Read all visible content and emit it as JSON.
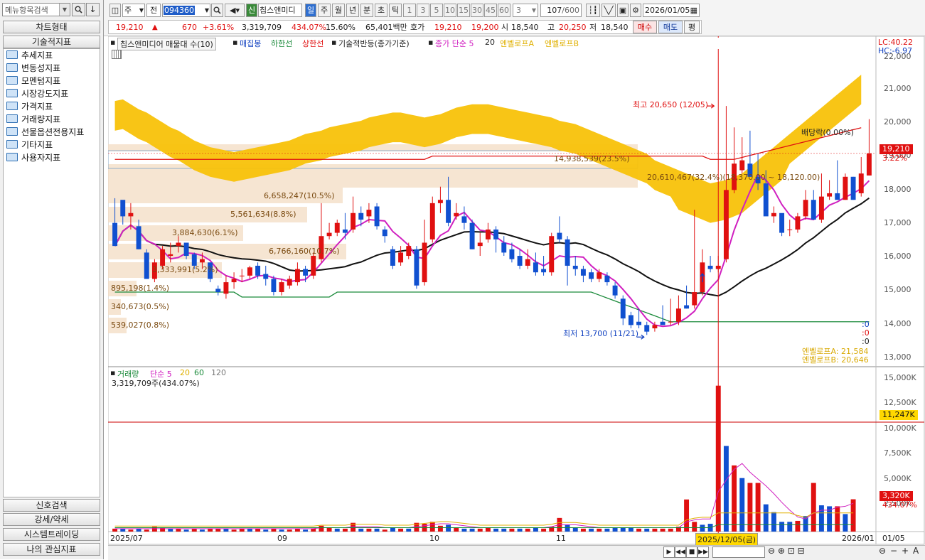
{
  "left_panel": {
    "search_placeholder": "메뉴항목검색",
    "chart_type": "차트형태",
    "tech_indicators": "기술적지표",
    "tree": [
      "추세지표",
      "변동성지표",
      "모멘텀지표",
      "시장강도지표",
      "가격지표",
      "거래량지표",
      "선물옵션전용지표",
      "기타지표",
      "사용자지표"
    ],
    "bottom": [
      "신호검색",
      "강세/약세",
      "시스템트레이딩",
      "나의 관심지표"
    ]
  },
  "toolbar": {
    "mode1": "주",
    "mode2": "전",
    "code": "094360",
    "stock_name": "칩스앤미디",
    "signal": "신",
    "periods": [
      "일",
      "주",
      "월",
      "년",
      "분",
      "초",
      "틱"
    ],
    "intervals": [
      "1",
      "3",
      "5",
      "10",
      "15",
      "30",
      "45",
      "60"
    ],
    "interval_select": "3",
    "count": "107",
    "count_total": "/600",
    "date": "2026/01/05"
  },
  "quote": {
    "price": "19,210",
    "change_arrow": "▲",
    "change": "670",
    "change_pct": "+3.61%",
    "volume": "3,319,709",
    "volume_ratio": "434.07%",
    "turnover": "15.60%",
    "amount": "65,401백만",
    "ask_label": "호가",
    "ask": "19,210",
    "bid": "19,200",
    "open_label": "시",
    "open": "18,540",
    "high_label": "고",
    "high": "20,250",
    "low_label": "저",
    "low": "18,540",
    "buy": "매수",
    "sell": "매도",
    "eval": "평"
  },
  "legend": {
    "title": "칩스앤미디어 매물대 수(10)",
    "items": [
      {
        "label": "매집봉",
        "color": "#1040c0"
      },
      {
        "label": "하한선",
        "color": "#1a8a3a"
      },
      {
        "label": "상한선",
        "color": "#e01010"
      },
      {
        "label": "기술적반등(종가기준)",
        "color": "#222222"
      },
      {
        "label": "종가 단순 5",
        "color": "#d020c0"
      },
      {
        "label": "20",
        "color": "#222222"
      },
      {
        "label": "엔벨로프A",
        "color": "#e0b000"
      },
      {
        "label": "엔벨로프B",
        "color": "#e0b000"
      }
    ],
    "lc": "LC:40.22",
    "hc": "HC:-6.97"
  },
  "annotations": {
    "high": "최고 20,650 (12/05)",
    "low": "최저 13,700 (11/21)",
    "dividend": "배당락(0.00%)",
    "price_box": "19,210",
    "price_pct": "3.22%",
    "env_a": "엔벨로프A: 21,584",
    "env_b": "엔벨로프B: 20,646",
    "zeros": [
      ":0",
      ":0",
      ":0"
    ],
    "profile": [
      "14,938,539(23.5%)",
      "20,610,467(32.4%)(18,370.00 ~ 18,120.00)",
      "6,658,247(10.5%)",
      "5,561,634(8.8%)",
      "3,884,630(6.1%)",
      "6,766,160(10.7%)",
      "3,333,991(5.2%)",
      "895,198(1.4%)",
      "340,673(0.5%)",
      "539,027(0.8%)"
    ]
  },
  "price_axis": [
    "22,000",
    "21,000",
    "20,000",
    "19,000",
    "18,000",
    "17,000",
    "16,000",
    "15,000",
    "14,000",
    "13,000"
  ],
  "volume_panel": {
    "legend_title": "거래량",
    "legend_items": [
      {
        "label": "단순 5",
        "color": "#d020c0"
      },
      {
        "label": "20",
        "color": "#e0b000"
      },
      {
        "label": "60",
        "color": "#1a8a3a"
      },
      {
        "label": "120",
        "color": "#777777"
      }
    ],
    "value": "3,319,709주(434.07%)",
    "axis": [
      "15,000K",
      "12,500K",
      "10,000K",
      "7,500K",
      "5,000K",
      "2,500K"
    ],
    "line_box": "11,247K",
    "vol_box": "3,320K",
    "vol_pct": "434.07%"
  },
  "x_axis": {
    "labels": [
      "2025/07",
      "09",
      "10",
      "11",
      "2026/01"
    ],
    "crosshair_date": "2025/12/05(금)",
    "right_label": "01/05"
  },
  "chart_data": {
    "type": "candlestick",
    "price_range": [
      12800,
      22400
    ],
    "volume_range": [
      0,
      16000
    ],
    "candles": [
      [
        17100,
        18100,
        17850,
        16400,
        16400
      ],
      [
        17800,
        17850,
        17600,
        17050,
        17300
      ],
      [
        17300,
        17450,
        17700,
        16900,
        17400
      ],
      [
        17000,
        17200,
        17200,
        16300,
        16300
      ],
      [
        16200,
        16250,
        16300,
        15400,
        15400
      ],
      [
        15400,
        16200,
        16000,
        15300,
        15900
      ],
      [
        15800,
        16000,
        16400,
        15700,
        16300
      ],
      [
        16100,
        16700,
        16500,
        15900,
        16150
      ],
      [
        16400,
        16300,
        16700,
        16200,
        16500
      ],
      [
        16500,
        16200,
        16500,
        16000,
        16100
      ],
      [
        16150,
        15800,
        16200,
        15700,
        15800
      ],
      [
        15900,
        16100,
        16200,
        15700,
        16000
      ],
      [
        15900,
        15400,
        15900,
        15300,
        15400
      ],
      [
        15100,
        15100,
        15200,
        14900,
        15000
      ],
      [
        14950,
        15300,
        15500,
        14800,
        15300
      ],
      [
        15300,
        15400,
        15600,
        15100,
        15400
      ],
      [
        15500,
        15600,
        15700,
        15300,
        15500
      ],
      [
        15500,
        15700,
        15800,
        15400,
        15750
      ],
      [
        15800,
        15600,
        15900,
        15400,
        15500
      ],
      [
        15550,
        15300,
        15800,
        15200,
        15400
      ],
      [
        15400,
        15200,
        15500,
        14900,
        15000
      ],
      [
        15000,
        15200,
        15400,
        14900,
        15300
      ],
      [
        15200,
        15300,
        15500,
        15100,
        15400
      ],
      [
        15300,
        15700,
        15900,
        15200,
        15700
      ],
      [
        15700,
        15400,
        15800,
        15300,
        15500
      ],
      [
        15500,
        15900,
        16200,
        15400,
        16100
      ],
      [
        16000,
        16500,
        17700,
        15900,
        16700
      ],
      [
        16700,
        16900,
        17100,
        16600,
        16800
      ],
      [
        16800,
        17000,
        17200,
        16700,
        17100
      ],
      [
        16900,
        16700,
        17400,
        16600,
        16800
      ],
      [
        16900,
        17500,
        17900,
        16800,
        17400
      ],
      [
        17400,
        17300,
        17600,
        17000,
        17200
      ],
      [
        17300,
        17500,
        17700,
        17100,
        17500
      ],
      [
        17600,
        17000,
        17700,
        16900,
        17000
      ],
      [
        16900,
        16600,
        17000,
        16500,
        16700
      ],
      [
        16300,
        15800,
        16400,
        15700,
        15800
      ],
      [
        15900,
        16200,
        16400,
        15800,
        16200
      ],
      [
        16100,
        16300,
        16500,
        16000,
        16400
      ],
      [
        16300,
        15100,
        16400,
        15100,
        15200
      ],
      [
        15300,
        16600,
        17200,
        15200,
        16500
      ],
      [
        16600,
        17800,
        17900,
        16500,
        17700
      ],
      [
        17700,
        18000,
        18200,
        17400,
        17800
      ],
      [
        17800,
        17700,
        18500,
        17000,
        17100
      ],
      [
        17300,
        17500,
        17700,
        17200,
        17400
      ],
      [
        17300,
        17000,
        17600,
        16900,
        17100
      ],
      [
        17100,
        16700,
        17200,
        16300,
        16300
      ],
      [
        16400,
        16600,
        16800,
        16100,
        16500
      ],
      [
        16600,
        16800,
        17100,
        16500,
        16900
      ],
      [
        16900,
        16700,
        17000,
        16200,
        16600
      ],
      [
        16500,
        16300,
        16700,
        16100,
        16200
      ],
      [
        16300,
        16100,
        16500,
        15900,
        16000
      ],
      [
        16100,
        15900,
        16300,
        15700,
        15800
      ],
      [
        15800,
        16100,
        16300,
        15700,
        16000
      ],
      [
        15900,
        15800,
        16200,
        15500,
        15600
      ],
      [
        15700,
        15900,
        16100,
        15500,
        15600
      ],
      [
        15600,
        16400,
        16800,
        15500,
        16700
      ],
      [
        16800,
        17200,
        17300,
        16500,
        16600
      ],
      [
        16600,
        16200,
        16700,
        15200,
        15800
      ],
      [
        15800,
        15900,
        16100,
        15500,
        15700
      ],
      [
        15700,
        15400,
        15800,
        15300,
        15500
      ],
      [
        15600,
        15500,
        15700,
        15300,
        15400
      ],
      [
        15400,
        15500,
        15700,
        15300,
        15600
      ],
      [
        15500,
        15400,
        15600,
        15200,
        15300
      ],
      [
        15200,
        15000,
        15300,
        14800,
        14900
      ],
      [
        14800,
        14200,
        14900,
        14000,
        14200
      ],
      [
        14300,
        14100,
        14400,
        13900,
        14000
      ],
      [
        14100,
        14400,
        14500,
        13900,
        14000
      ],
      [
        14000,
        13900,
        14100,
        13700,
        13800
      ],
      [
        13900,
        14000,
        14100,
        13800,
        14000
      ],
      [
        14100,
        14500,
        14600,
        14000,
        14000
      ],
      [
        14100,
        14600,
        14800,
        14000,
        14100
      ],
      [
        14100,
        14700,
        14900,
        14000,
        14500
      ],
      [
        14600,
        15100,
        15200,
        14500,
        14500
      ],
      [
        14600,
        15200,
        17500,
        14500,
        15000
      ],
      [
        15000,
        15800,
        16300,
        14900,
        15900
      ],
      [
        15800,
        15900,
        16100,
        15600,
        15700
      ],
      [
        15700,
        15900,
        16100,
        15600,
        15800
      ],
      [
        16000,
        18100,
        20650,
        15900,
        18100
      ],
      [
        18100,
        18800,
        20000,
        18000,
        18900
      ],
      [
        18700,
        19000,
        19700,
        18600,
        19000
      ],
      [
        18900,
        19100,
        19900,
        18500,
        18500
      ],
      [
        18500,
        18200,
        19200,
        18100,
        18300
      ],
      [
        18300,
        17500,
        18700,
        17400,
        17300
      ],
      [
        17300,
        17400,
        17600,
        17100,
        17400
      ],
      [
        17400,
        17100,
        17300,
        16700,
        16800
      ],
      [
        16900,
        17000,
        17200,
        16700,
        16900
      ],
      [
        16900,
        17200,
        17400,
        16800,
        17300
      ],
      [
        17300,
        17600,
        18100,
        17200,
        17800
      ],
      [
        17800,
        17600,
        18100,
        17200,
        17200
      ],
      [
        17200,
        17300,
        18600,
        17100,
        17900
      ],
      [
        17900,
        17900,
        18400,
        17800,
        18000
      ],
      [
        18000,
        18600,
        19000,
        17900,
        17800
      ],
      [
        17800,
        18200,
        18600,
        17800,
        18500
      ],
      [
        18500,
        17900,
        18500,
        17800,
        17800
      ],
      [
        18000,
        18800,
        19100,
        17900,
        18600
      ],
      [
        18540,
        19210,
        20250,
        18540,
        19210
      ]
    ],
    "volume_bars": [
      [
        "r",
        300
      ],
      [
        "b",
        300
      ],
      [
        "r",
        200
      ],
      [
        "b",
        300
      ],
      [
        "r",
        200
      ],
      [
        "r",
        500
      ],
      [
        "r",
        400
      ],
      [
        "b",
        300
      ],
      [
        "r",
        300
      ],
      [
        "b",
        200
      ],
      [
        "r",
        300
      ],
      [
        "b",
        200
      ],
      [
        "r",
        300
      ],
      [
        "r",
        300
      ],
      [
        "b",
        300
      ],
      [
        "r",
        200
      ],
      [
        "r",
        300
      ],
      [
        "b",
        300
      ],
      [
        "r",
        300
      ],
      [
        "b",
        200
      ],
      [
        "r",
        300
      ],
      [
        "b",
        200
      ],
      [
        "r",
        200
      ],
      [
        "r",
        300
      ],
      [
        "b",
        200
      ],
      [
        "r",
        300
      ],
      [
        "r",
        600
      ],
      [
        "r",
        400
      ],
      [
        "b",
        300
      ],
      [
        "r",
        300
      ],
      [
        "r",
        900
      ],
      [
        "b",
        300
      ],
      [
        "r",
        300
      ],
      [
        "b",
        300
      ],
      [
        "r",
        200
      ],
      [
        "b",
        400
      ],
      [
        "r",
        300
      ],
      [
        "b",
        300
      ],
      [
        "r",
        900
      ],
      [
        "r",
        800
      ],
      [
        "r",
        1000
      ],
      [
        "r",
        600
      ],
      [
        "b",
        700
      ],
      [
        "r",
        400
      ],
      [
        "b",
        300
      ],
      [
        "b",
        300
      ],
      [
        "r",
        300
      ],
      [
        "r",
        400
      ],
      [
        "b",
        300
      ],
      [
        "b",
        300
      ],
      [
        "r",
        300
      ],
      [
        "b",
        300
      ],
      [
        "r",
        300
      ],
      [
        "b",
        400
      ],
      [
        "r",
        300
      ],
      [
        "r",
        500
      ],
      [
        "r",
        1400
      ],
      [
        "b",
        700
      ],
      [
        "b",
        400
      ],
      [
        "r",
        300
      ],
      [
        "b",
        300
      ],
      [
        "r",
        300
      ],
      [
        "b",
        300
      ],
      [
        "b",
        400
      ],
      [
        "b",
        400
      ],
      [
        "b",
        400
      ],
      [
        "r",
        300
      ],
      [
        "b",
        300
      ],
      [
        "r",
        300
      ],
      [
        "r",
        300
      ],
      [
        "r",
        300
      ],
      [
        "r",
        500
      ],
      [
        "r",
        3300
      ],
      [
        "r",
        1000
      ],
      [
        "b",
        700
      ],
      [
        "b",
        800
      ],
      [
        "r",
        15000
      ],
      [
        "b",
        8800
      ],
      [
        "r",
        6800
      ],
      [
        "b",
        5500
      ],
      [
        "r",
        5000
      ],
      [
        "r",
        5000
      ],
      [
        "b",
        2800
      ],
      [
        "b",
        2000
      ],
      [
        "b",
        1000
      ],
      [
        "b",
        1000
      ],
      [
        "r",
        1100
      ],
      [
        "b",
        1600
      ],
      [
        "r",
        5000
      ],
      [
        "b",
        2700
      ],
      [
        "b",
        2600
      ],
      [
        "r",
        2600
      ],
      [
        "b",
        1800
      ],
      [
        "r",
        3320
      ]
    ],
    "ma5_vol": [
      0.3,
      0.3,
      0.3,
      0.3,
      0.3,
      0.3,
      0.3,
      0.3,
      0.3,
      0.3,
      0.3,
      0.3,
      0.3,
      0.3,
      0.3,
      0.3,
      0.3,
      0.3,
      0.3,
      0.3,
      0.3,
      0.3,
      0.3,
      0.3,
      0.3,
      0.3,
      0.4,
      0.4,
      0.4,
      0.4,
      0.5,
      0.5,
      0.5,
      0.5,
      0.4,
      0.4,
      0.4,
      0.4,
      0.5,
      0.6,
      0.7,
      0.8,
      0.8,
      0.7,
      0.6,
      0.5,
      0.4,
      0.4,
      0.4,
      0.4,
      0.4,
      0.4,
      0.4,
      0.4,
      0.4,
      0.5,
      0.7,
      0.7,
      0.7,
      0.6,
      0.5,
      0.4,
      0.4,
      0.4,
      0.4,
      0.4,
      0.4,
      0.4,
      0.4,
      0.4,
      0.4,
      0.4,
      1.0,
      1.2,
      1.3,
      1.3,
      4.1,
      5.3,
      6.4,
      7.0,
      6.1,
      5.4,
      4.7,
      3.9,
      3.0,
      2.2,
      1.5,
      1.3,
      1.9,
      2.2,
      2.2,
      2.5,
      2.6,
      2.9
    ]
  }
}
